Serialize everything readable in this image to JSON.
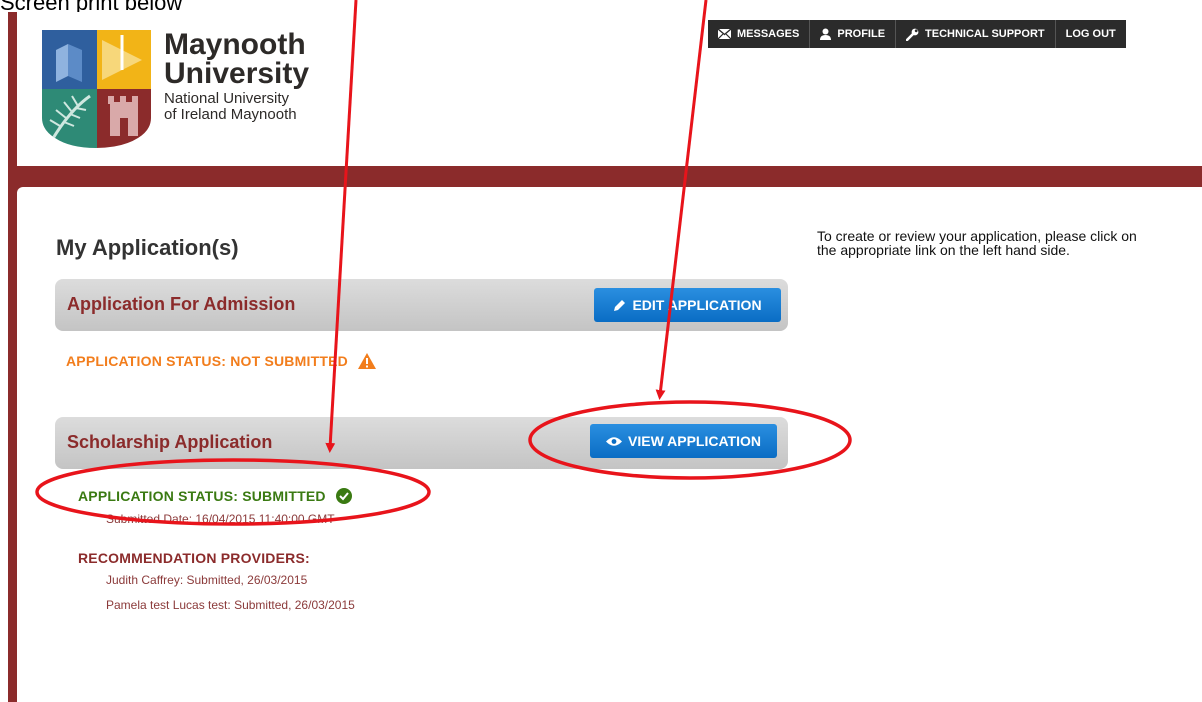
{
  "caption": "Screen print below",
  "logo": {
    "line1": "Maynooth",
    "line2": "University",
    "sub1": "National University",
    "sub2": "of Ireland Maynooth"
  },
  "nav": {
    "messages": "MESSAGES",
    "profile": "PROFILE",
    "support": "TECHNICAL SUPPORT",
    "logout": "LOG OUT"
  },
  "main": {
    "title": "My Application(s)",
    "side_note": "To create or review your application, please click on the appropriate link on the left hand side.",
    "admission": {
      "title": "Application For Admission",
      "button": "EDIT APPLICATION",
      "status": "APPLICATION STATUS: NOT SUBMITTED"
    },
    "scholarship": {
      "title": "Scholarship Application",
      "button": "VIEW APPLICATION",
      "status": "APPLICATION STATUS: SUBMITTED",
      "submitted_date": "Submitted Date: 16/04/2015 11:40:00 GMT",
      "providers_heading": "RECOMMENDATION PROVIDERS:",
      "providers": [
        "Judith Caffrey: Submitted, 26/03/2015",
        "Pamela test Lucas test: Submitted, 26/03/2015"
      ]
    }
  },
  "colors": {
    "brand_maroon": "#8b2b2b",
    "status_warning": "#f27d1c",
    "status_success": "#3a7a12",
    "button_blue": "#0a6dc4",
    "annotation_red": "#e8141b"
  },
  "icons": {
    "messages": "envelope-icon",
    "profile": "user-icon",
    "support": "wrench-icon",
    "edit": "pencil-icon",
    "view": "eye-icon",
    "warning": "warning-icon",
    "success": "check-circle-icon"
  }
}
